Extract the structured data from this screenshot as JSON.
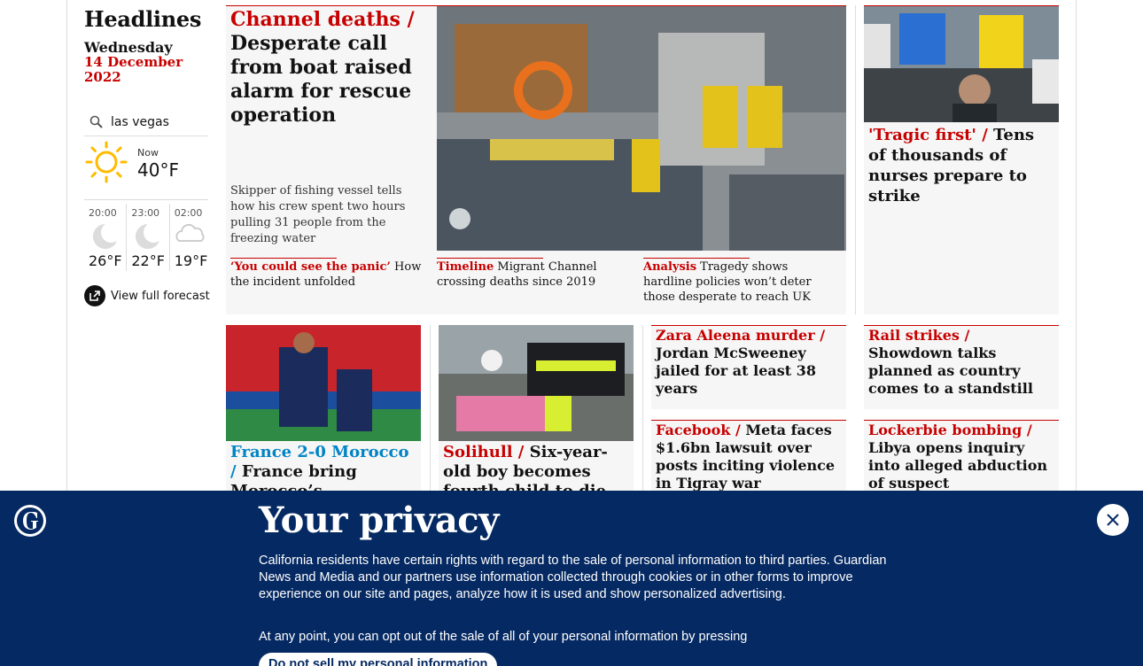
{
  "sidebar": {
    "title": "Headlines",
    "day": "Wednesday",
    "date": "14 December 2022",
    "weather": {
      "location": "las vegas",
      "now_label": "Now",
      "now_temp": "40°F",
      "forecast": [
        {
          "time": "20:00",
          "temp": "26°F",
          "icon": "moon-icon"
        },
        {
          "time": "23:00",
          "temp": "22°F",
          "icon": "moon-icon"
        },
        {
          "time": "02:00",
          "temp": "19°F",
          "icon": "cloud-icon"
        }
      ],
      "full_forecast": "View full forecast"
    }
  },
  "top_story": {
    "kicker": "Channel deaths /",
    "headline": "Desperate call from boat raised alarm for rescue operation",
    "standfirst": "Skipper of fishing vessel tells how his crew spent two hours pulling 31 people from the freezing water",
    "sublinks": [
      {
        "kicker": "‘You could see the panic’",
        "text": "How the incident unfolded"
      },
      {
        "kicker": "Timeline",
        "text": "Migrant Channel crossing deaths since 2019"
      },
      {
        "kicker": "Analysis",
        "text": "Tragedy shows hardline policies won’t deter those desperate to reach UK"
      }
    ]
  },
  "right_story": {
    "kicker": "'Tragic first' /",
    "headline": "Tens of thousands of nurses prepare to strike"
  },
  "cards": [
    {
      "kicker": "France 2-0 Morocco /",
      "headline": "France bring Morocco’s"
    },
    {
      "kicker": "Solihull /",
      "headline": "Six-year-old boy becomes fourth child to die after fall"
    }
  ],
  "text_cards": [
    {
      "kicker": "Zara Aleena murder /",
      "headline": "Jordan McSweeney jailed for at least 38 years"
    },
    {
      "kicker": "Rail strikes /",
      "headline": "Showdown talks planned as country comes to a standstill"
    },
    {
      "kicker": "Facebook /",
      "headline": "Meta faces $1.6bn lawsuit over posts inciting violence in Tigray war"
    },
    {
      "kicker": "Lockerbie bombing /",
      "headline": "Libya opens inquiry into alleged abduction of suspect"
    }
  ],
  "privacy": {
    "title": "Your privacy",
    "text": "California residents have certain rights with regard to the sale of personal information to third parties. Guardian News and Media and our partners use information collected through cookies or in other forms to improve experience on our site and pages, analyze how it is used and show personalized advertising.",
    "text2": "At any point, you can opt out of the sale of all of your personal information by pressing",
    "button": "Do not sell my personal information"
  }
}
